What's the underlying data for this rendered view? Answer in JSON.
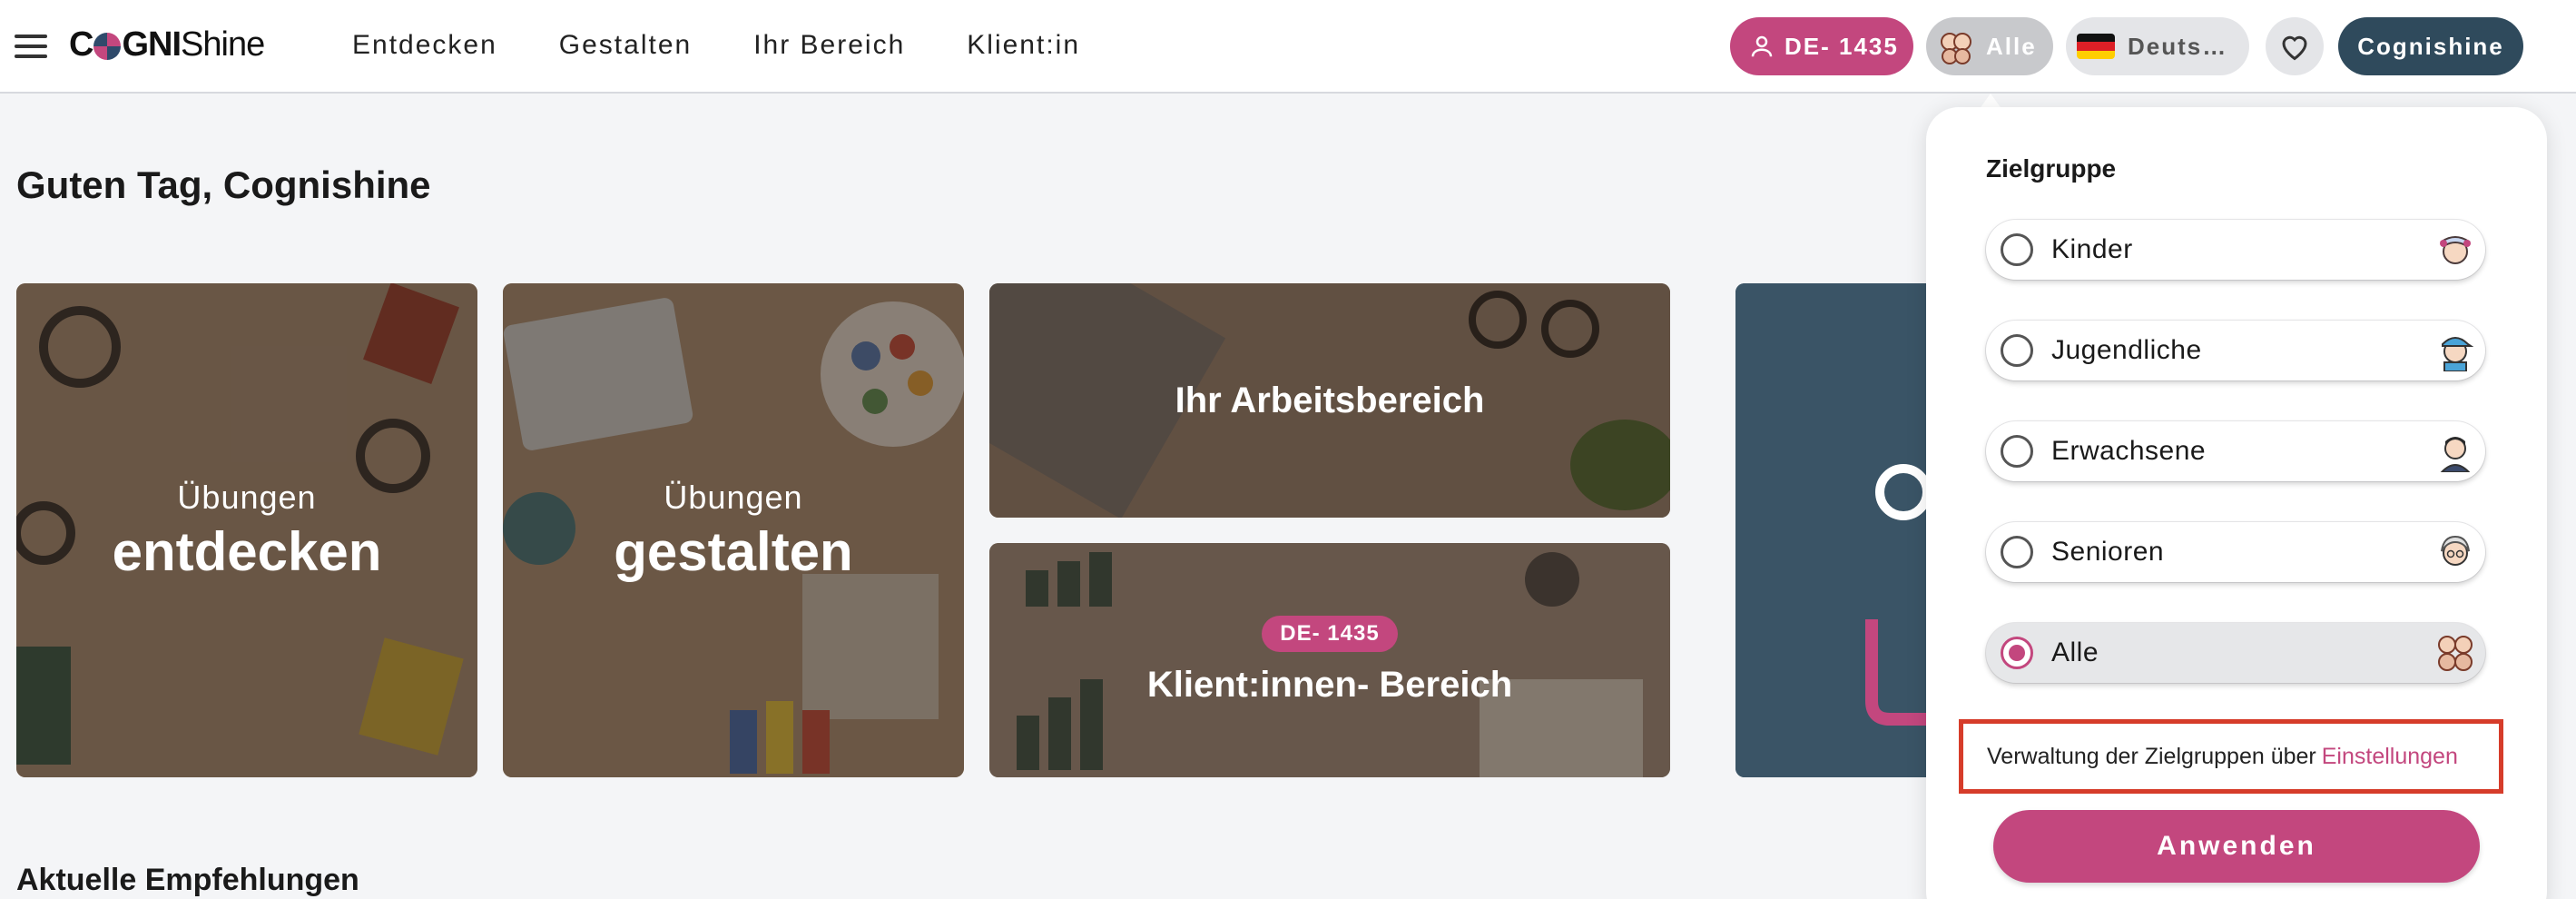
{
  "header": {
    "logo_bold": "CO",
    "logo_bold2": "GNI",
    "logo_thin": "Shine",
    "nav": [
      "Entdecken",
      "Gestalten",
      "Ihr Bereich",
      "Klient:in"
    ],
    "user_id": "DE- 1435",
    "audience_label": "Alle",
    "language_label": "Deuts…",
    "account_label": "Cognishine"
  },
  "main": {
    "greeting": "Guten Tag, Cognishine",
    "tiles": {
      "explore_small": "Übungen",
      "explore_big": "entdecken",
      "create_small": "Übungen",
      "create_big": "gestalten",
      "workspace": "Ihr Arbeitsbereich",
      "client_badge": "DE- 1435",
      "client_area": "Klient:innen- Bereich"
    },
    "recommendations_heading": "Aktuelle Empfehlungen"
  },
  "dropdown": {
    "title": "Zielgruppe",
    "options": [
      {
        "label": "Kinder",
        "selected": false,
        "icon": "child-avatar-icon"
      },
      {
        "label": "Jugendliche",
        "selected": false,
        "icon": "teen-avatar-icon"
      },
      {
        "label": "Erwachsene",
        "selected": false,
        "icon": "adult-avatar-icon"
      },
      {
        "label": "Senioren",
        "selected": false,
        "icon": "senior-avatar-icon"
      },
      {
        "label": "Alle",
        "selected": true,
        "icon": "group-avatar-icon"
      }
    ],
    "manage_text": "Verwaltung der Zielgruppen über",
    "manage_link": "Einstellungen",
    "apply_label": "Anwenden"
  },
  "colors": {
    "accent": "#c3477e",
    "dark": "#2f4a5c",
    "highlight_border": "#d63c2a"
  }
}
